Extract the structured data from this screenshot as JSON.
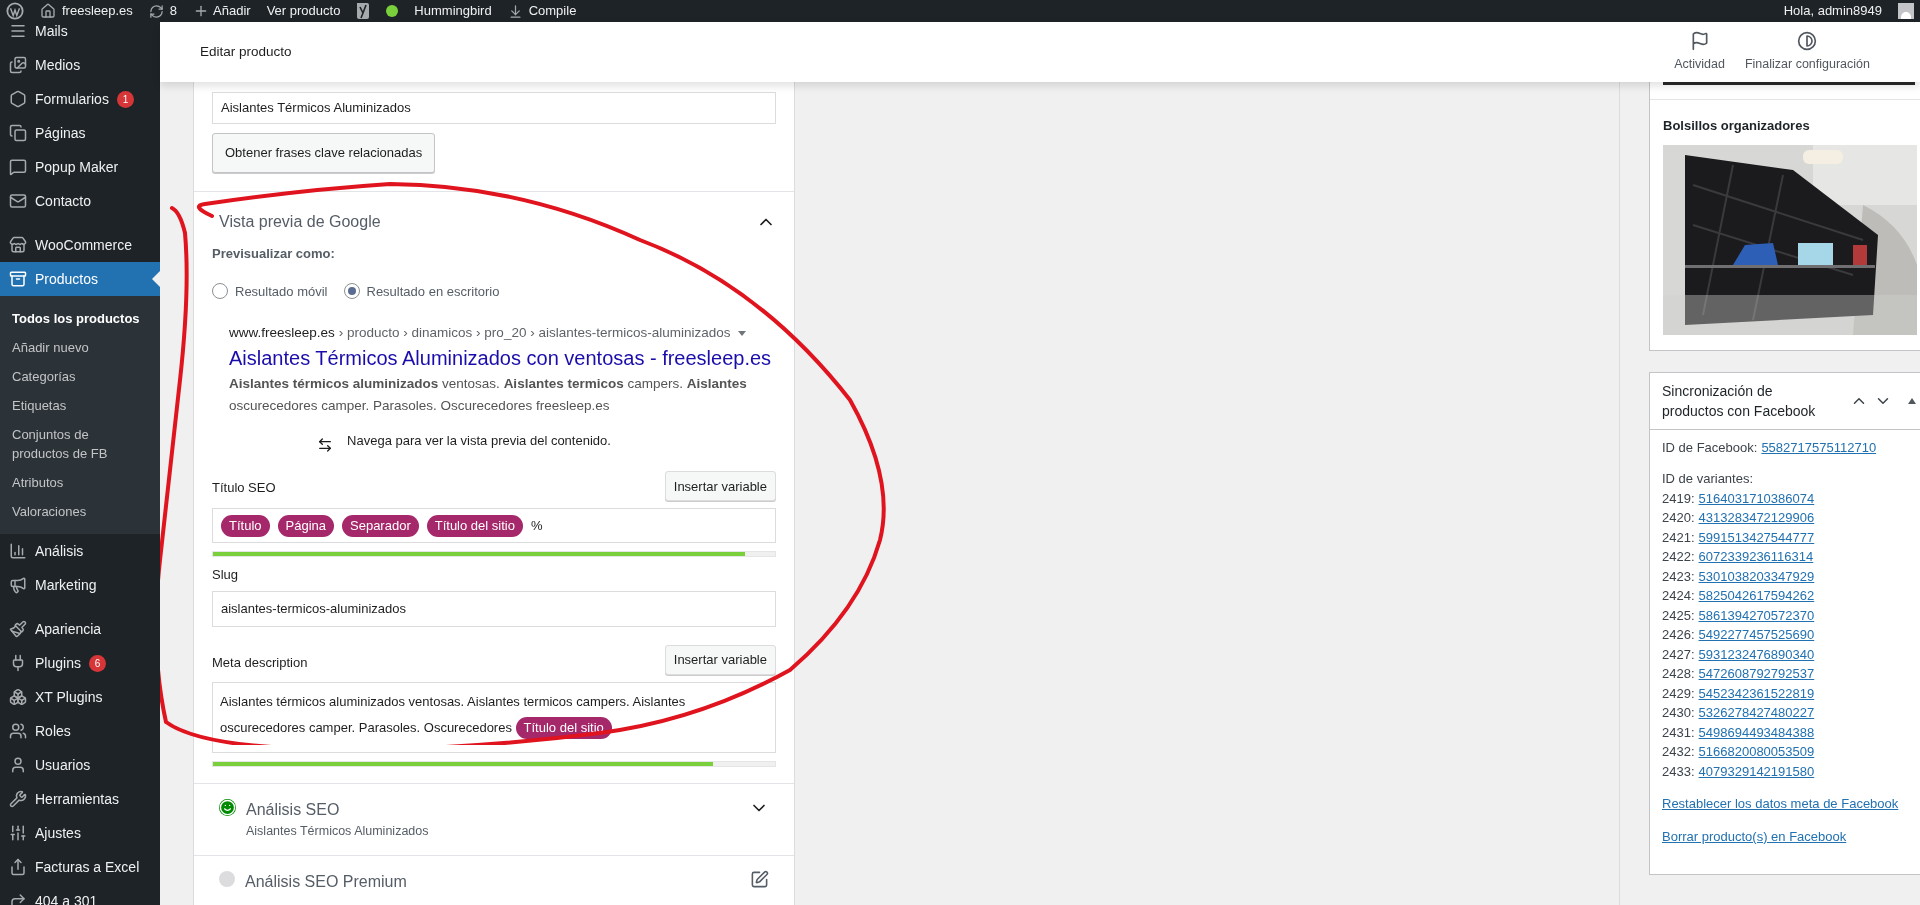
{
  "admin_bar": {
    "site": "freesleep.es",
    "updates": "8",
    "new": "Añadir",
    "view": "Ver producto",
    "status": "Hummingbird",
    "compile": "Compile",
    "greeting": "Hola, admin8949"
  },
  "sidebar": {
    "groups": [
      {
        "items": [
          {
            "label": "Mails",
            "selected": false
          },
          {
            "label": "Medios",
            "selected": false
          },
          {
            "label": "Formularios",
            "badge": "1",
            "selected": false
          },
          {
            "label": "Páginas",
            "selected": false
          },
          {
            "label": "Popup Maker",
            "selected": false
          },
          {
            "label": "Contacto",
            "selected": false
          }
        ]
      },
      {
        "items": [
          {
            "label": "WooCommerce",
            "selected": false
          },
          {
            "label": "Productos",
            "selected": true,
            "children": [
              {
                "label": "Todos los productos",
                "selected": true
              },
              {
                "label": "Añadir nuevo",
                "selected": false
              },
              {
                "label": "Categorías",
                "selected": false
              },
              {
                "label": "Etiquetas",
                "selected": false
              },
              {
                "label": "Conjuntos de productos de FB",
                "selected": false
              },
              {
                "label": "Atributos",
                "selected": false
              },
              {
                "label": "Valoraciones",
                "selected": false
              }
            ]
          },
          {
            "label": "Análisis",
            "selected": false
          },
          {
            "label": "Marketing",
            "selected": false
          }
        ]
      },
      {
        "items": [
          {
            "label": "Apariencia",
            "selected": false
          },
          {
            "label": "Plugins",
            "badge": "6",
            "selected": false
          },
          {
            "label": "XT Plugins",
            "selected": false
          },
          {
            "label": "Roles",
            "selected": false
          },
          {
            "label": "Usuarios",
            "selected": false
          },
          {
            "label": "Herramientas",
            "selected": false
          },
          {
            "label": "Ajustes",
            "selected": false
          },
          {
            "label": "Facturas a Excel",
            "selected": false
          },
          {
            "label": "404 a 301",
            "selected": false
          }
        ]
      }
    ]
  },
  "header": {
    "title": "Editar producto",
    "actions": [
      "Actividad",
      "Finalizar configuración"
    ]
  },
  "seo": {
    "keyword_value": "Aislantes Térmicos Aluminizados",
    "related_button": "Obtener frases clave relacionadas",
    "preview": {
      "title": "Vista previa de Google",
      "expanded": true,
      "preview_as": "Previsualizar como:",
      "options": [
        {
          "label": "Resultado móvil",
          "selected": false
        },
        {
          "label": "Resultado en escritorio",
          "selected": true
        }
      ],
      "url": "www.freesleep.es",
      "breadcrumb": "› producto › dinamicos › pro_20 › aislantes-termicos-aluminizados",
      "result_title": "Aislantes Térmicos Aluminizados con ventosas - freesleep.es",
      "result_description": "**Aislantes térmicos aluminizados** ventosas. **Aislantes termicos** campers. **Aislantes** oscurecedores camper. Parasoles. Oscurecedores freesleep.es",
      "navigate_hint": "Navega para ver la vista previa del contenido."
    },
    "seo_title": {
      "label": "Título SEO",
      "button": "Insertar variable",
      "chips": [
        "Título",
        "Página",
        "Separador",
        "Título del sitio"
      ],
      "trailing": "%",
      "level": 0.946
    },
    "slug": {
      "label": "Slug",
      "value": "aislantes-termicos-aluminizados"
    },
    "meta": {
      "label": "Meta description",
      "button": "Insertar variable",
      "text": "Aislantes térmicos aluminizados ventosas. Aislantes termicos campers. Aislantes oscurecedores camper. Parasoles. Oscurecedores",
      "chip": "Título del sitio",
      "level": 0.89
    },
    "sections": [
      {
        "kind": "score",
        "title": "Análisis SEO",
        "subtitle": "Aislantes Térmicos Aluminizados",
        "expanded": false
      },
      {
        "kind": "premium",
        "title": "Análisis SEO Premium"
      }
    ]
  },
  "gallery": {
    "caption": "Bolsillos organizadores"
  },
  "facebook": {
    "title": "Sincronización de productos con Facebook",
    "id_label": "ID de Facebook:",
    "id": "5582717575112710",
    "variants_label": "ID de variantes:",
    "variants": [
      {
        "id": "2419:",
        "value": "5164031710386074"
      },
      {
        "id": "2420:",
        "value": "4313283472129906"
      },
      {
        "id": "2421:",
        "value": "5991513427544777"
      },
      {
        "id": "2422:",
        "value": "6072339236116314"
      },
      {
        "id": "2423:",
        "value": "5301038203347929"
      },
      {
        "id": "2424:",
        "value": "5825042617594262"
      },
      {
        "id": "2425:",
        "value": "5861394270572370"
      },
      {
        "id": "2426:",
        "value": "5492277457525690"
      },
      {
        "id": "2427:",
        "value": "5931232476890340"
      },
      {
        "id": "2428:",
        "value": "5472608792792537"
      },
      {
        "id": "2429:",
        "value": "5452342361522819"
      },
      {
        "id": "2430:",
        "value": "5326278427480227"
      },
      {
        "id": "2431:",
        "value": "5498694493484388"
      },
      {
        "id": "2432:",
        "value": "5166820080053509"
      },
      {
        "id": "2433:",
        "value": "4079329142191580"
      }
    ],
    "links": [
      "Restablecer los datos meta de Facebook",
      "Borrar producto(s) en Facebook"
    ]
  }
}
